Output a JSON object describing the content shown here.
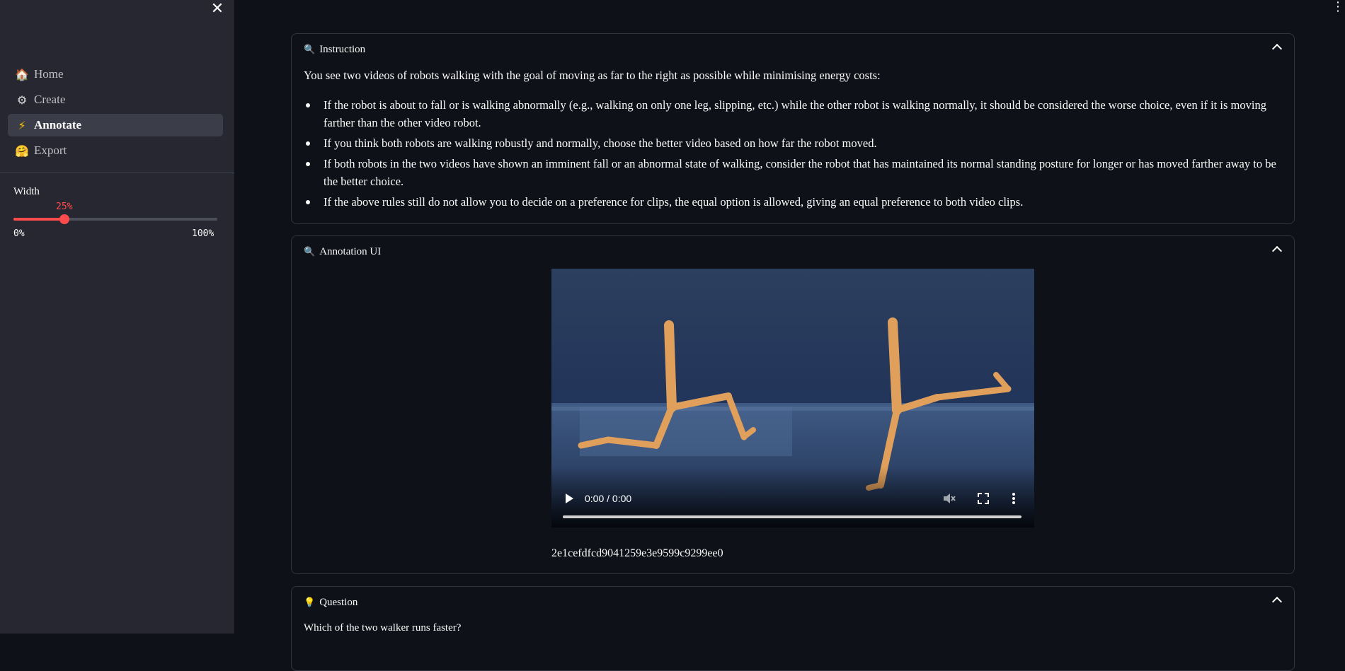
{
  "sidebar": {
    "nav": [
      {
        "icon": "house-icon",
        "glyph": "🏠",
        "label": "Home",
        "active": false
      },
      {
        "icon": "gear-icon",
        "glyph": "⚙",
        "label": "Create",
        "active": false
      },
      {
        "icon": "lightning-icon",
        "glyph": "⚡",
        "label": "Annotate",
        "active": true
      },
      {
        "icon": "hugging-face-icon",
        "glyph": "🤗",
        "label": "Export",
        "active": false
      }
    ],
    "slider": {
      "label": "Width",
      "value": 25,
      "value_text": "25%",
      "min_text": "0%",
      "max_text": "100%"
    }
  },
  "instruction": {
    "icon": "magnifier-icon",
    "title": "Instruction",
    "intro": "You see two videos of robots walking with the goal of moving as far to the right as possible while minimising energy costs:",
    "rules": [
      "If the robot is about to fall or is walking abnormally (e.g., walking on only one leg, slipping, etc.) while the other robot is walking normally, it should be considered the worse choice, even if it is moving farther than the other video robot.",
      "If you think both robots are walking robustly and normally, choose the better video based on how far the robot moved.",
      "If both robots in the two videos have shown an imminent fall or an abnormal state of walking, consider the robot that has maintained its normal standing posture for longer or has moved farther away to be the better choice.",
      "If the above rules still do not allow you to decide on a preference for clips, the equal option is allowed, giving an equal preference to both video clips."
    ]
  },
  "annotation": {
    "icon": "magnifier-icon",
    "title": "Annotation UI",
    "video": {
      "time": "0:00 / 0:00",
      "progress": 0
    },
    "video_id": "2e1cefdfcd9041259e3e9599c9299ee0"
  },
  "question": {
    "icon": "lightbulb-icon",
    "title": "Question",
    "text": "Which of the two walker runs faster?"
  },
  "colors": {
    "background": "#0e1117",
    "sidebar": "#262730",
    "accent": "#ff4b4b",
    "border": "#31333f"
  }
}
